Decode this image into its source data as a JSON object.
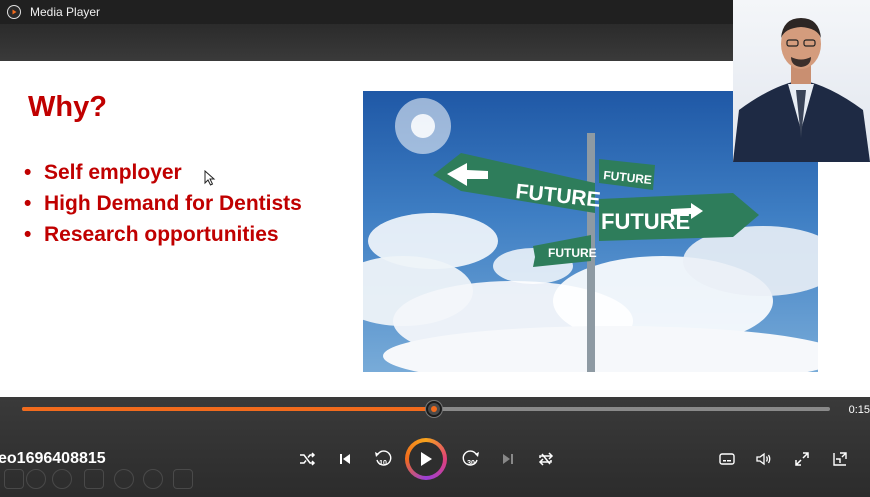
{
  "window": {
    "title": "Media Player"
  },
  "slide": {
    "heading": "Why?",
    "bullets": [
      "Self employer",
      "High Demand for Dentists",
      "Research opportunities"
    ],
    "image_signs": [
      "FUTURE",
      "FUTURE",
      "FUTURE",
      "FUTURE"
    ]
  },
  "player": {
    "file_name": "eo1696408815",
    "elapsed": "0:15",
    "progress_fraction": 0.51,
    "accent": "#f26b1d",
    "controls": [
      "shuffle-icon",
      "previous-icon",
      "rewind-10-icon",
      "play-icon",
      "forward-30-icon",
      "next-icon",
      "repeat-icon",
      "captions-icon",
      "volume-icon",
      "fullscreen-icon",
      "miniplayer-icon"
    ],
    "skip_back_label": "10",
    "skip_forward_label": "30"
  }
}
